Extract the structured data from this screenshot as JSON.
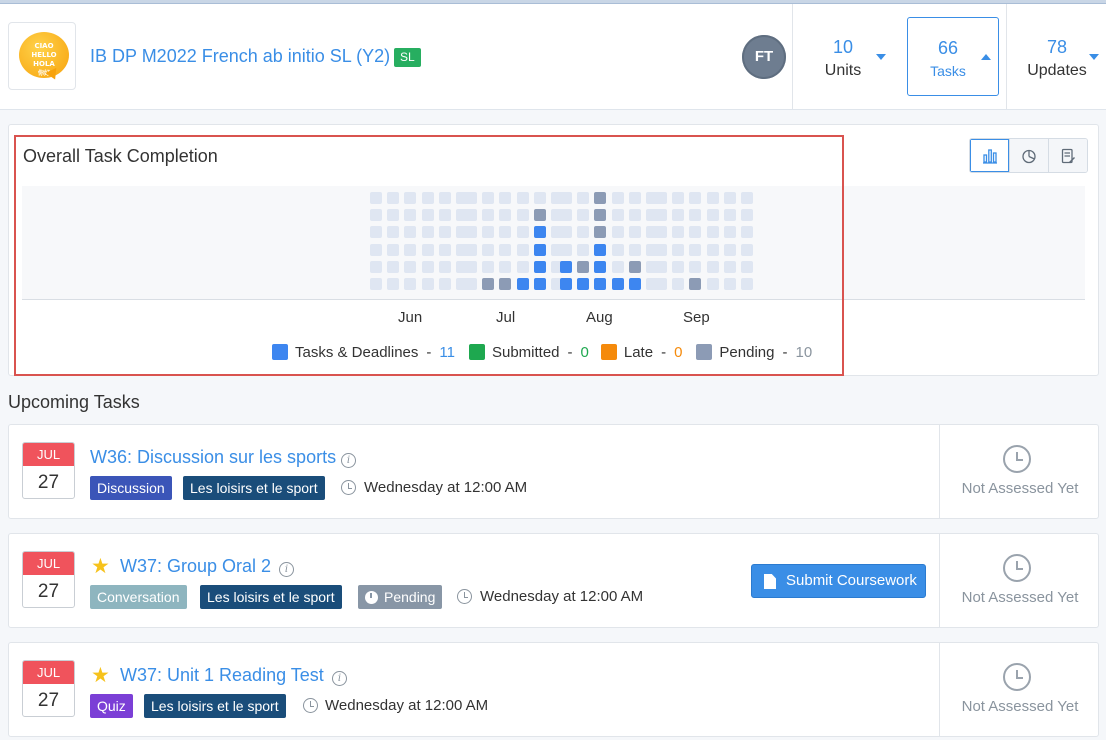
{
  "header": {
    "logo_words": [
      "CIAO",
      "HELLO",
      "HOLA",
      "你好"
    ],
    "course_title": "IB DP M2022 French ab initio SL (Y2)",
    "course_badge": "SL",
    "avatar_initials": "FT",
    "stats": [
      {
        "value": "10",
        "label": "Units",
        "active": false
      },
      {
        "value": "66",
        "label": "Tasks",
        "active": true
      },
      {
        "value": "78",
        "label": "Updates",
        "active": false
      }
    ]
  },
  "chart_panel": {
    "title": "Overall Task Completion",
    "view_buttons": [
      "bar-chart-icon",
      "pie-chart-icon",
      "report-icon"
    ]
  },
  "chart_data": {
    "type": "heatmap",
    "title": "Overall Task Completion",
    "months": [
      "Jun",
      "Jul",
      "Aug",
      "Sep"
    ],
    "grid": "each month shown as 6 columns x 6 rows of cells; rows listed top to bottom; 0 = empty, 1 = Tasks & Deadlines, 4 = Pending",
    "cells": {
      "Jun": [
        [
          0,
          0,
          0,
          0,
          0,
          0
        ],
        [
          0,
          0,
          0,
          0,
          0,
          0
        ],
        [
          0,
          0,
          0,
          0,
          0,
          0
        ],
        [
          0,
          0,
          0,
          0,
          0,
          0
        ],
        [
          0,
          0,
          0,
          0,
          0,
          0
        ],
        [
          0,
          0,
          0,
          0,
          0,
          0
        ]
      ],
      "Jul": [
        [
          0,
          0,
          0,
          0,
          0,
          0
        ],
        [
          0,
          0,
          0,
          0,
          4,
          0
        ],
        [
          0,
          0,
          0,
          0,
          1,
          0
        ],
        [
          0,
          0,
          0,
          0,
          1,
          0
        ],
        [
          0,
          0,
          0,
          0,
          1,
          0
        ],
        [
          0,
          4,
          4,
          1,
          1,
          0
        ]
      ],
      "Aug": [
        [
          0,
          0,
          4,
          0,
          0,
          0
        ],
        [
          0,
          0,
          4,
          0,
          0,
          0
        ],
        [
          0,
          0,
          4,
          0,
          0,
          0
        ],
        [
          0,
          0,
          1,
          0,
          0,
          0
        ],
        [
          1,
          4,
          1,
          0,
          4,
          0
        ],
        [
          1,
          1,
          1,
          1,
          1,
          0
        ]
      ],
      "Sep": [
        [
          0,
          0,
          0,
          0,
          0,
          0
        ],
        [
          0,
          0,
          0,
          0,
          0,
          0
        ],
        [
          0,
          0,
          0,
          0,
          0,
          0
        ],
        [
          0,
          0,
          0,
          0,
          0,
          0
        ],
        [
          0,
          0,
          0,
          0,
          0,
          0
        ],
        [
          0,
          0,
          4,
          0,
          0,
          0
        ]
      ]
    },
    "legend": [
      {
        "label": "Tasks & Deadlines",
        "count": "11",
        "color": "#3d86f0",
        "count_color": "#3a8ee6"
      },
      {
        "label": "Submitted",
        "count": "0",
        "color": "#1ea84f",
        "count_color": "#1ea84f"
      },
      {
        "label": "Late",
        "count": "0",
        "color": "#f58a0b",
        "count_color": "#f58a0b"
      },
      {
        "label": "Pending",
        "count": "10",
        "color": "#8c9bb5",
        "count_color": "#8a949e"
      }
    ],
    "colors": {
      "empty": "#dfe6f2",
      "tasks": "#3d86f0",
      "pending": "#8c9bb5"
    }
  },
  "upcoming": {
    "title": "Upcoming Tasks",
    "tasks": [
      {
        "month": "JUL",
        "day": "27",
        "starred": false,
        "title": "W36: Discussion sur les sports",
        "tags": [
          {
            "text": "Discussion",
            "kind": "discussion"
          },
          {
            "text": "Les loisirs et le sport",
            "kind": "topic"
          }
        ],
        "due": "Wednesday at 12:00 AM",
        "submit_label": "",
        "assessment": "Not Assessed Yet"
      },
      {
        "month": "JUL",
        "day": "27",
        "starred": true,
        "title": "W37: Group Oral 2",
        "tags": [
          {
            "text": "Conversation",
            "kind": "conversation"
          },
          {
            "text": "Les loisirs et le sport",
            "kind": "topic"
          },
          {
            "text": "Pending",
            "kind": "pending"
          }
        ],
        "due": "Wednesday at 12:00 AM",
        "submit_label": "Submit Coursework",
        "assessment": "Not Assessed Yet"
      },
      {
        "month": "JUL",
        "day": "27",
        "starred": true,
        "title": "W37: Unit 1 Reading Test",
        "tags": [
          {
            "text": "Quiz",
            "kind": "quiz"
          },
          {
            "text": "Les loisirs et le sport",
            "kind": "topic"
          }
        ],
        "due": "Wednesday at 12:00 AM",
        "submit_label": "",
        "assessment": "Not Assessed Yet"
      }
    ]
  }
}
